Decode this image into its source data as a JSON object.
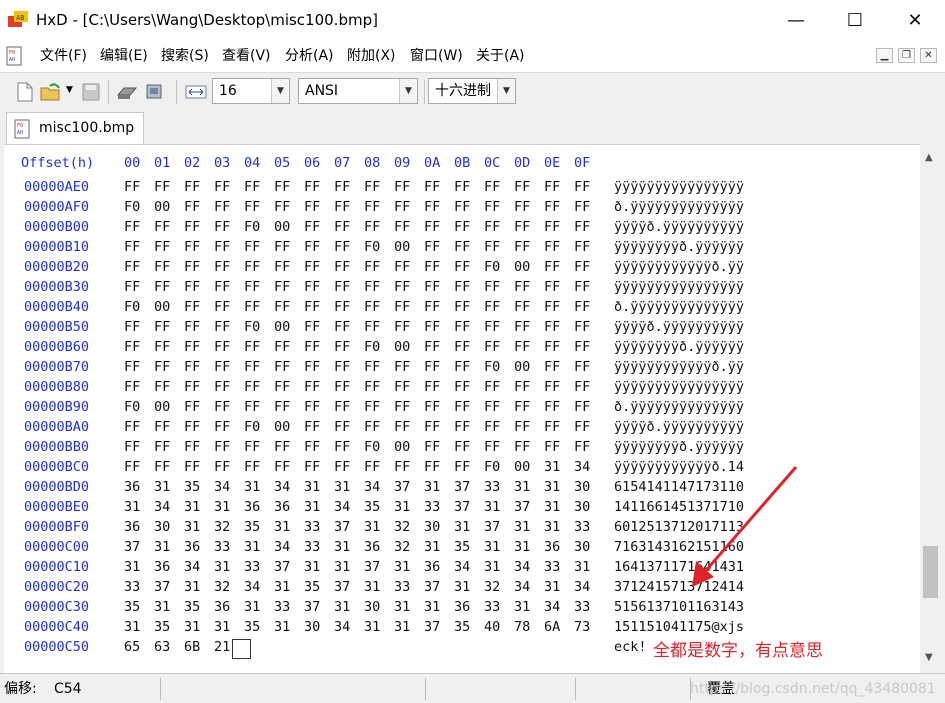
{
  "window": {
    "title": "HxD - [C:\\Users\\Wang\\Desktop\\misc100.bmp]",
    "minimize_glyph": "—",
    "maximize_glyph": "☐",
    "close_glyph": "✕"
  },
  "menu": {
    "items": [
      "文件(F)",
      "编辑(E)",
      "搜索(S)",
      "查看(V)",
      "分析(A)",
      "附加(X)",
      "窗口(W)",
      "关于(A)"
    ]
  },
  "toolbar": {
    "bytes_per_row": "16",
    "charset": "ANSI",
    "offset_base": "十六进制",
    "icons": [
      "new-file-icon",
      "open-file-icon",
      "save-icon",
      "open-disk-icon",
      "open-ram-icon",
      "bytes-per-row-icon"
    ]
  },
  "tab": {
    "label": "misc100.bmp"
  },
  "editor": {
    "offset_header": "Offset(h)",
    "column_headers": [
      "00",
      "01",
      "02",
      "03",
      "04",
      "05",
      "06",
      "07",
      "08",
      "09",
      "0A",
      "0B",
      "0C",
      "0D",
      "0E",
      "0F"
    ],
    "rows": [
      {
        "offset": "00000AE0",
        "hex": [
          "FF",
          "FF",
          "FF",
          "FF",
          "FF",
          "FF",
          "FF",
          "FF",
          "FF",
          "FF",
          "FF",
          "FF",
          "FF",
          "FF",
          "FF",
          "FF"
        ],
        "ascii": "ÿÿÿÿÿÿÿÿÿÿÿÿÿÿÿÿ"
      },
      {
        "offset": "00000AF0",
        "hex": [
          "F0",
          "00",
          "FF",
          "FF",
          "FF",
          "FF",
          "FF",
          "FF",
          "FF",
          "FF",
          "FF",
          "FF",
          "FF",
          "FF",
          "FF",
          "FF"
        ],
        "ascii": "ð.ÿÿÿÿÿÿÿÿÿÿÿÿÿÿ"
      },
      {
        "offset": "00000B00",
        "hex": [
          "FF",
          "FF",
          "FF",
          "FF",
          "F0",
          "00",
          "FF",
          "FF",
          "FF",
          "FF",
          "FF",
          "FF",
          "FF",
          "FF",
          "FF",
          "FF"
        ],
        "ascii": "ÿÿÿÿð.ÿÿÿÿÿÿÿÿÿÿ"
      },
      {
        "offset": "00000B10",
        "hex": [
          "FF",
          "FF",
          "FF",
          "FF",
          "FF",
          "FF",
          "FF",
          "FF",
          "F0",
          "00",
          "FF",
          "FF",
          "FF",
          "FF",
          "FF",
          "FF"
        ],
        "ascii": "ÿÿÿÿÿÿÿÿð.ÿÿÿÿÿÿ"
      },
      {
        "offset": "00000B20",
        "hex": [
          "FF",
          "FF",
          "FF",
          "FF",
          "FF",
          "FF",
          "FF",
          "FF",
          "FF",
          "FF",
          "FF",
          "FF",
          "F0",
          "00",
          "FF",
          "FF"
        ],
        "ascii": "ÿÿÿÿÿÿÿÿÿÿÿÿð.ÿÿ"
      },
      {
        "offset": "00000B30",
        "hex": [
          "FF",
          "FF",
          "FF",
          "FF",
          "FF",
          "FF",
          "FF",
          "FF",
          "FF",
          "FF",
          "FF",
          "FF",
          "FF",
          "FF",
          "FF",
          "FF"
        ],
        "ascii": "ÿÿÿÿÿÿÿÿÿÿÿÿÿÿÿÿ"
      },
      {
        "offset": "00000B40",
        "hex": [
          "F0",
          "00",
          "FF",
          "FF",
          "FF",
          "FF",
          "FF",
          "FF",
          "FF",
          "FF",
          "FF",
          "FF",
          "FF",
          "FF",
          "FF",
          "FF"
        ],
        "ascii": "ð.ÿÿÿÿÿÿÿÿÿÿÿÿÿÿ"
      },
      {
        "offset": "00000B50",
        "hex": [
          "FF",
          "FF",
          "FF",
          "FF",
          "F0",
          "00",
          "FF",
          "FF",
          "FF",
          "FF",
          "FF",
          "FF",
          "FF",
          "FF",
          "FF",
          "FF"
        ],
        "ascii": "ÿÿÿÿð.ÿÿÿÿÿÿÿÿÿÿ"
      },
      {
        "offset": "00000B60",
        "hex": [
          "FF",
          "FF",
          "FF",
          "FF",
          "FF",
          "FF",
          "FF",
          "FF",
          "F0",
          "00",
          "FF",
          "FF",
          "FF",
          "FF",
          "FF",
          "FF"
        ],
        "ascii": "ÿÿÿÿÿÿÿÿð.ÿÿÿÿÿÿ"
      },
      {
        "offset": "00000B70",
        "hex": [
          "FF",
          "FF",
          "FF",
          "FF",
          "FF",
          "FF",
          "FF",
          "FF",
          "FF",
          "FF",
          "FF",
          "FF",
          "F0",
          "00",
          "FF",
          "FF"
        ],
        "ascii": "ÿÿÿÿÿÿÿÿÿÿÿÿð.ÿÿ"
      },
      {
        "offset": "00000B80",
        "hex": [
          "FF",
          "FF",
          "FF",
          "FF",
          "FF",
          "FF",
          "FF",
          "FF",
          "FF",
          "FF",
          "FF",
          "FF",
          "FF",
          "FF",
          "FF",
          "FF"
        ],
        "ascii": "ÿÿÿÿÿÿÿÿÿÿÿÿÿÿÿÿ"
      },
      {
        "offset": "00000B90",
        "hex": [
          "F0",
          "00",
          "FF",
          "FF",
          "FF",
          "FF",
          "FF",
          "FF",
          "FF",
          "FF",
          "FF",
          "FF",
          "FF",
          "FF",
          "FF",
          "FF"
        ],
        "ascii": "ð.ÿÿÿÿÿÿÿÿÿÿÿÿÿÿ"
      },
      {
        "offset": "00000BA0",
        "hex": [
          "FF",
          "FF",
          "FF",
          "FF",
          "F0",
          "00",
          "FF",
          "FF",
          "FF",
          "FF",
          "FF",
          "FF",
          "FF",
          "FF",
          "FF",
          "FF"
        ],
        "ascii": "ÿÿÿÿð.ÿÿÿÿÿÿÿÿÿÿ"
      },
      {
        "offset": "00000BB0",
        "hex": [
          "FF",
          "FF",
          "FF",
          "FF",
          "FF",
          "FF",
          "FF",
          "FF",
          "F0",
          "00",
          "FF",
          "FF",
          "FF",
          "FF",
          "FF",
          "FF"
        ],
        "ascii": "ÿÿÿÿÿÿÿÿð.ÿÿÿÿÿÿ"
      },
      {
        "offset": "00000BC0",
        "hex": [
          "FF",
          "FF",
          "FF",
          "FF",
          "FF",
          "FF",
          "FF",
          "FF",
          "FF",
          "FF",
          "FF",
          "FF",
          "F0",
          "00",
          "31",
          "34"
        ],
        "ascii": "ÿÿÿÿÿÿÿÿÿÿÿÿð.14"
      },
      {
        "offset": "00000BD0",
        "hex": [
          "36",
          "31",
          "35",
          "34",
          "31",
          "34",
          "31",
          "31",
          "34",
          "37",
          "31",
          "37",
          "33",
          "31",
          "31",
          "30"
        ],
        "ascii": "6154141147173110"
      },
      {
        "offset": "00000BE0",
        "hex": [
          "31",
          "34",
          "31",
          "31",
          "36",
          "36",
          "31",
          "34",
          "35",
          "31",
          "33",
          "37",
          "31",
          "37",
          "31",
          "30"
        ],
        "ascii": "1411661451371710"
      },
      {
        "offset": "00000BF0",
        "hex": [
          "36",
          "30",
          "31",
          "32",
          "35",
          "31",
          "33",
          "37",
          "31",
          "32",
          "30",
          "31",
          "37",
          "31",
          "31",
          "33"
        ],
        "ascii": "6012513712017113"
      },
      {
        "offset": "00000C00",
        "hex": [
          "37",
          "31",
          "36",
          "33",
          "31",
          "34",
          "33",
          "31",
          "36",
          "32",
          "31",
          "35",
          "31",
          "31",
          "36",
          "30"
        ],
        "ascii": "7163143162151160"
      },
      {
        "offset": "00000C10",
        "hex": [
          "31",
          "36",
          "34",
          "31",
          "33",
          "37",
          "31",
          "31",
          "37",
          "31",
          "36",
          "34",
          "31",
          "34",
          "33",
          "31"
        ],
        "ascii": "1641371171641431"
      },
      {
        "offset": "00000C20",
        "hex": [
          "33",
          "37",
          "31",
          "32",
          "34",
          "31",
          "35",
          "37",
          "31",
          "33",
          "37",
          "31",
          "32",
          "34",
          "31",
          "34"
        ],
        "ascii": "3712415713712414"
      },
      {
        "offset": "00000C30",
        "hex": [
          "35",
          "31",
          "35",
          "36",
          "31",
          "33",
          "37",
          "31",
          "30",
          "31",
          "31",
          "36",
          "33",
          "31",
          "34",
          "33"
        ],
        "ascii": "5156137101163143"
      },
      {
        "offset": "00000C40",
        "hex": [
          "31",
          "35",
          "31",
          "31",
          "35",
          "31",
          "30",
          "34",
          "31",
          "31",
          "37",
          "35",
          "40",
          "78",
          "6A",
          "73"
        ],
        "ascii": "151151041175@xjs"
      },
      {
        "offset": "00000C50",
        "hex": [
          "65",
          "63",
          "6B",
          "21"
        ],
        "ascii": "eck!"
      }
    ]
  },
  "annotation": {
    "text": "全都是数字，有点意思",
    "color": "#e0232a"
  },
  "statusbar": {
    "offset_label": "偏移:",
    "offset_value": "C54",
    "mode": "覆盖"
  },
  "watermark": {
    "text": "https://blog.csdn.net/qq_43480081"
  },
  "colors": {
    "offset_blue": "#2030d8",
    "annotation_red": "#e0232a"
  }
}
